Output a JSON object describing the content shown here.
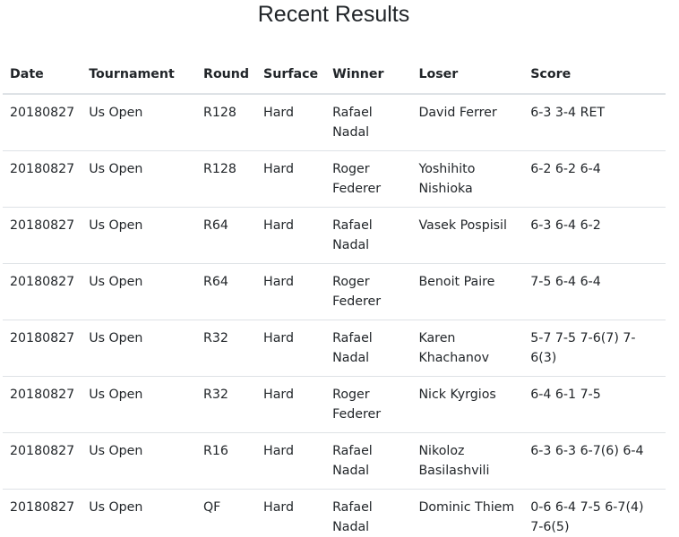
{
  "page": {
    "title": "Recent Results"
  },
  "table": {
    "headers": [
      "Date",
      "Tournament",
      "Round",
      "Surface",
      "Winner",
      "Loser",
      "Score"
    ],
    "rows": [
      [
        "20180827",
        "Us Open",
        "R128",
        "Hard",
        "Rafael Nadal",
        "David Ferrer",
        "6-3 3-4 RET"
      ],
      [
        "20180827",
        "Us Open",
        "R128",
        "Hard",
        "Roger Federer",
        "Yoshihito Nishioka",
        "6-2 6-2 6-4"
      ],
      [
        "20180827",
        "Us Open",
        "R64",
        "Hard",
        "Rafael Nadal",
        "Vasek Pospisil",
        "6-3 6-4 6-2"
      ],
      [
        "20180827",
        "Us Open",
        "R64",
        "Hard",
        "Roger Federer",
        "Benoit Paire",
        "7-5 6-4 6-4"
      ],
      [
        "20180827",
        "Us Open",
        "R32",
        "Hard",
        "Rafael Nadal",
        "Karen Khachanov",
        "5-7 7-5 7-6(7) 7-6(3)"
      ],
      [
        "20180827",
        "Us Open",
        "R32",
        "Hard",
        "Roger Federer",
        "Nick Kyrgios",
        "6-4 6-1 7-5"
      ],
      [
        "20180827",
        "Us Open",
        "R16",
        "Hard",
        "Rafael Nadal",
        "Nikoloz Basilashvili",
        "6-3 6-3 6-7(6) 6-4"
      ],
      [
        "20180827",
        "Us Open",
        "QF",
        "Hard",
        "Rafael Nadal",
        "Dominic Thiem",
        "0-6 6-4 7-5 6-7(4) 7-6(5)"
      ]
    ]
  }
}
